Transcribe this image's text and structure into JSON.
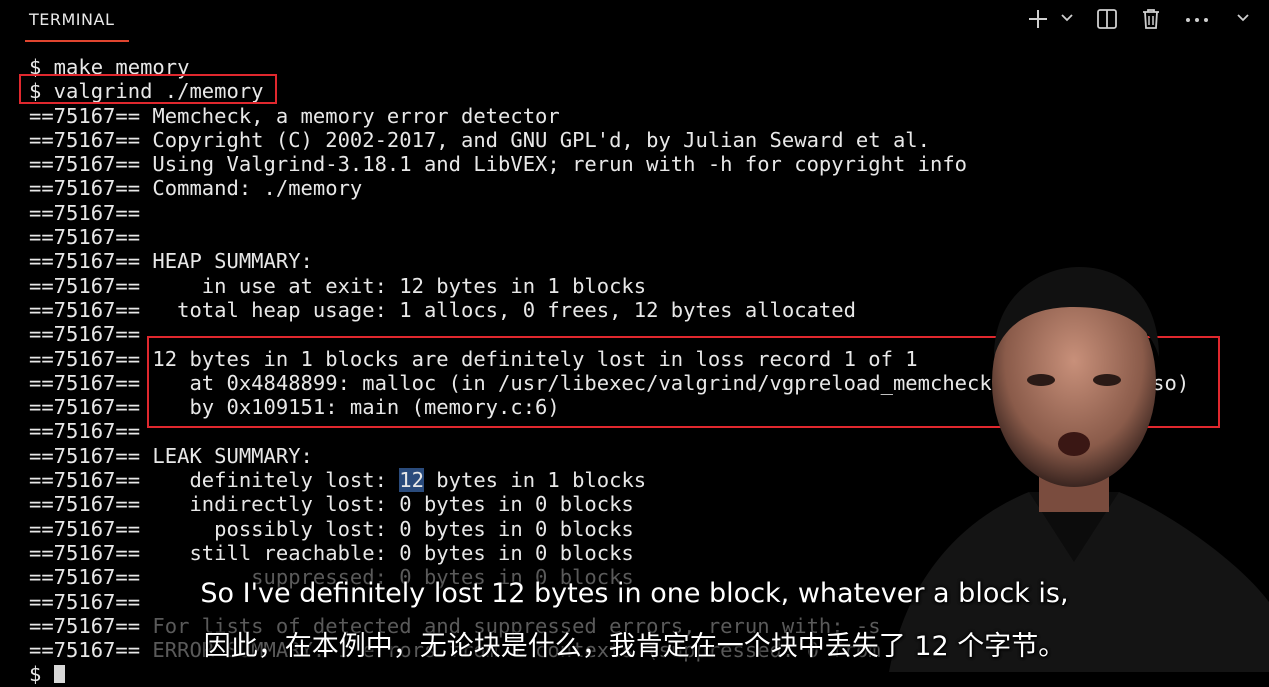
{
  "panel": {
    "tab_label": "TERMINAL",
    "actions": {
      "new_terminal_icon": "plus-icon",
      "dropdown_icon": "chevron-down-icon",
      "split_icon": "split-icon",
      "trash_icon": "trash-icon",
      "more_icon": "more-icon",
      "collapse_icon": "chevron-down-icon"
    },
    "accent_color": "#e0452f"
  },
  "terminal": {
    "lines": [
      {
        "prefix": "",
        "text": "$ make memory"
      },
      {
        "prefix": "",
        "text": "$ valgrind ./memory"
      },
      {
        "prefix": "==75167==",
        "text": " Memcheck, a memory error detector"
      },
      {
        "prefix": "==75167==",
        "text": " Copyright (C) 2002-2017, and GNU GPL'd, by Julian Seward et al."
      },
      {
        "prefix": "==75167==",
        "text": " Using Valgrind-3.18.1 and LibVEX; rerun with -h for copyright info"
      },
      {
        "prefix": "==75167==",
        "text": " Command: ./memory"
      },
      {
        "prefix": "==75167==",
        "text": ""
      },
      {
        "prefix": "==75167==",
        "text": ""
      },
      {
        "prefix": "==75167==",
        "text": " HEAP SUMMARY:"
      },
      {
        "prefix": "==75167==",
        "text": "     in use at exit: 12 bytes in 1 blocks"
      },
      {
        "prefix": "==75167==",
        "text": "   total heap usage: 1 allocs, 0 frees, 12 bytes allocated"
      },
      {
        "prefix": "==75167==",
        "text": ""
      },
      {
        "prefix": "==75167==",
        "text": " 12 bytes in 1 blocks are definitely lost in loss record 1 of 1"
      },
      {
        "prefix": "==75167==",
        "text": "    at 0x4848899: malloc (in /usr/libexec/valgrind/vgpreload_memcheck-amd64-linux.so)"
      },
      {
        "prefix": "==75167==",
        "text": "    by 0x109151: main (memory.c:6)"
      },
      {
        "prefix": "==75167==",
        "text": ""
      },
      {
        "prefix": "==75167==",
        "text": " LEAK SUMMARY:"
      },
      {
        "prefix": "==75167==",
        "text_before": "    definitely lost: ",
        "selected": "12",
        "text_after": " bytes in 1 blocks"
      },
      {
        "prefix": "==75167==",
        "text": "    indirectly lost: 0 bytes in 0 blocks"
      },
      {
        "prefix": "==75167==",
        "text": "      possibly lost: 0 bytes in 0 blocks"
      },
      {
        "prefix": "==75167==",
        "text": "    still reachable: 0 bytes in 0 blocks"
      },
      {
        "prefix": "==75167==",
        "text": "         suppressed: 0 bytes in 0 blocks"
      },
      {
        "prefix": "==75167==",
        "text": ""
      },
      {
        "prefix": "==75167==",
        "text": " For lists of detected and suppressed errors, rerun with: -s"
      },
      {
        "prefix": "==75167==",
        "text": " ERROR SUMMARY: 1 errors from 1 contexts (suppressed: 0 from 0)"
      },
      {
        "prefix": "",
        "text": "$ ",
        "cursor": true
      }
    ],
    "highlight_color": "#e0282e"
  },
  "captions": {
    "english": "So I've definitely lost 12 bytes in one block, whatever a block is,",
    "chinese": "因此，在本例中，无论块是什么，我肯定在一个块中丢失了 12 个字节。"
  }
}
